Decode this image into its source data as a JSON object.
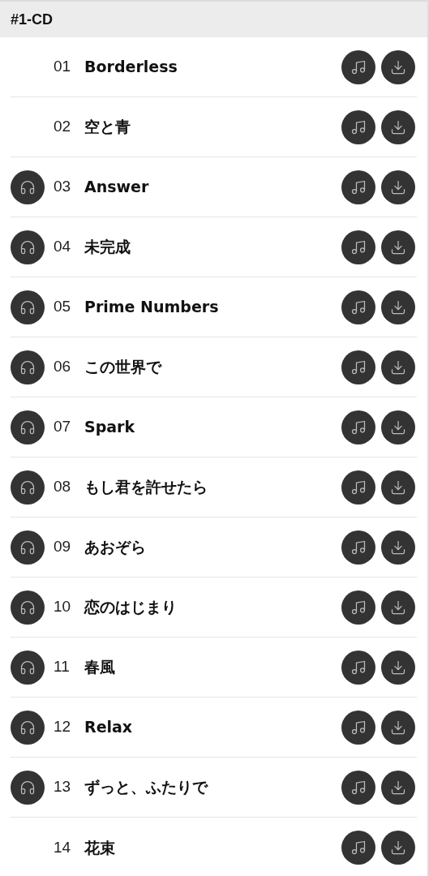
{
  "disc": {
    "title": "#1-CD"
  },
  "tracks": [
    {
      "number": "01",
      "title": "Borderless",
      "preview": false
    },
    {
      "number": "02",
      "title": "空と青",
      "preview": false
    },
    {
      "number": "03",
      "title": "Answer",
      "preview": true
    },
    {
      "number": "04",
      "title": "未完成",
      "preview": true
    },
    {
      "number": "05",
      "title": "Prime Numbers",
      "preview": true
    },
    {
      "number": "06",
      "title": "この世界で",
      "preview": true
    },
    {
      "number": "07",
      "title": "Spark",
      "preview": true
    },
    {
      "number": "08",
      "title": "もし君を許せたら",
      "preview": true
    },
    {
      "number": "09",
      "title": "あおぞら",
      "preview": true
    },
    {
      "number": "10",
      "title": "恋のはじまり",
      "preview": true
    },
    {
      "number": "11",
      "title": "春風",
      "preview": true
    },
    {
      "number": "12",
      "title": "Relax",
      "preview": true
    },
    {
      "number": "13",
      "title": "ずっと、ふたりで",
      "preview": true
    },
    {
      "number": "14",
      "title": "花束",
      "preview": false
    }
  ]
}
